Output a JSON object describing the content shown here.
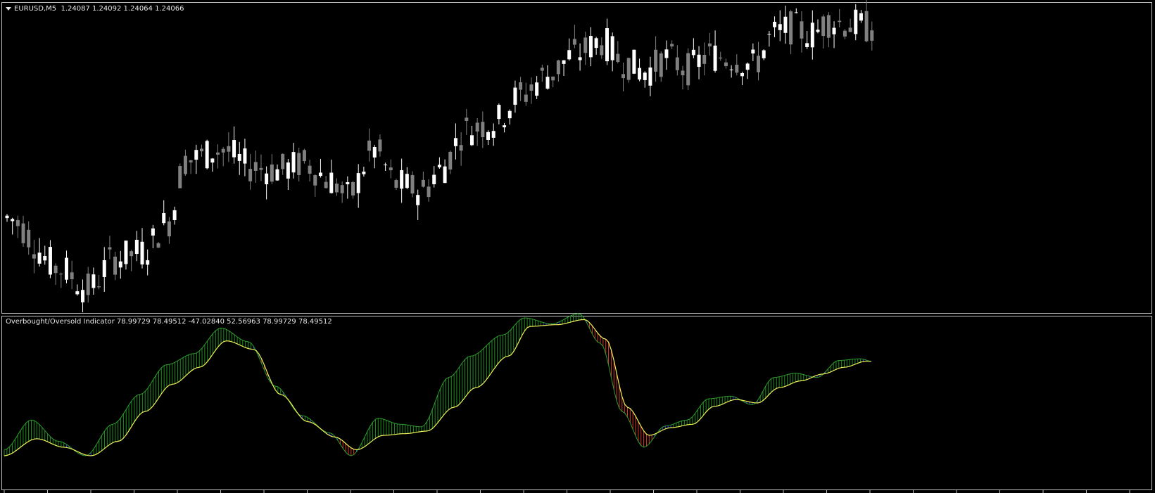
{
  "window": {
    "symbol": "EURUSD,M5",
    "ohlc": "1.24087 1.24092 1.24064 1.24066",
    "indicator_label": "Overbought/Oversold Indicator 78.99729 78.49512 -47.02840 52.56963 78.99729 78.49512"
  },
  "colors": {
    "background": "#000000",
    "border": "#c0c0c0",
    "bull_candle": "#ffffff",
    "bear_candle": "#808080",
    "osc_line_green": "#2e9b2e",
    "osc_line_yellow": "#f2f25a",
    "hist_green": "#1f8f1f",
    "hist_red": "#d43a2a",
    "hist_blue": "#2b3fd6"
  },
  "chart_data": [
    {
      "type": "candlestick",
      "title": "EURUSD,M5",
      "ylim": [
        1.2343,
        1.243
      ],
      "candle_count": 200,
      "anchors": [
        {
          "i": 0,
          "price": 1.237
        },
        {
          "i": 10,
          "price": 1.2355
        },
        {
          "i": 15,
          "price": 1.2349
        },
        {
          "i": 20,
          "price": 1.2358
        },
        {
          "i": 25,
          "price": 1.236
        },
        {
          "i": 30,
          "price": 1.2369
        },
        {
          "i": 33,
          "price": 1.2387
        },
        {
          "i": 40,
          "price": 1.239
        },
        {
          "i": 45,
          "price": 1.2385
        },
        {
          "i": 50,
          "price": 1.2384
        },
        {
          "i": 55,
          "price": 1.2386
        },
        {
          "i": 60,
          "price": 1.2381
        },
        {
          "i": 63,
          "price": 1.2376
        },
        {
          "i": 68,
          "price": 1.239
        },
        {
          "i": 72,
          "price": 1.238
        },
        {
          "i": 77,
          "price": 1.2378
        },
        {
          "i": 80,
          "price": 1.2384
        },
        {
          "i": 85,
          "price": 1.2396
        },
        {
          "i": 90,
          "price": 1.2398
        },
        {
          "i": 95,
          "price": 1.2406
        },
        {
          "i": 100,
          "price": 1.2412
        },
        {
          "i": 105,
          "price": 1.2418
        },
        {
          "i": 110,
          "price": 1.2422
        },
        {
          "i": 114,
          "price": 1.2416
        },
        {
          "i": 118,
          "price": 1.2413
        },
        {
          "i": 122,
          "price": 1.2417
        },
        {
          "i": 126,
          "price": 1.2414
        },
        {
          "i": 130,
          "price": 1.2418
        },
        {
          "i": 134,
          "price": 1.2417
        },
        {
          "i": 138,
          "price": 1.2415
        },
        {
          "i": 142,
          "price": 1.2424
        },
        {
          "i": 145,
          "price": 1.2426
        },
        {
          "i": 149,
          "price": 1.2424
        },
        {
          "i": 152,
          "price": 1.2428
        },
        {
          "i": 156,
          "price": 1.2427
        },
        {
          "i": 160,
          "price": 1.2426
        }
      ]
    },
    {
      "type": "line",
      "title": "Overbought/Oversold Indicator",
      "values_printed": [
        78.99729,
        78.49512,
        -47.0284,
        52.56963,
        78.99729,
        78.49512
      ],
      "ylim": [
        -100,
        100
      ],
      "series": [
        {
          "role": "fast",
          "anchors": [
            {
              "i": 0,
              "v": -55
            },
            {
              "i": 5,
              "v": -20
            },
            {
              "i": 10,
              "v": -45
            },
            {
              "i": 15,
              "v": -62
            },
            {
              "i": 20,
              "v": -25
            },
            {
              "i": 25,
              "v": 10
            },
            {
              "i": 30,
              "v": 45
            },
            {
              "i": 35,
              "v": 58
            },
            {
              "i": 40,
              "v": 88
            },
            {
              "i": 45,
              "v": 72
            },
            {
              "i": 50,
              "v": 20
            },
            {
              "i": 55,
              "v": -15
            },
            {
              "i": 60,
              "v": -35
            },
            {
              "i": 64,
              "v": -62
            },
            {
              "i": 69,
              "v": -18
            },
            {
              "i": 73,
              "v": -25
            },
            {
              "i": 77,
              "v": -28
            },
            {
              "i": 82,
              "v": 30
            },
            {
              "i": 86,
              "v": 55
            },
            {
              "i": 92,
              "v": 80
            },
            {
              "i": 96,
              "v": 100
            },
            {
              "i": 101,
              "v": 93
            },
            {
              "i": 106,
              "v": 105
            },
            {
              "i": 110,
              "v": 70
            },
            {
              "i": 114,
              "v": -10
            },
            {
              "i": 118,
              "v": -52
            },
            {
              "i": 122,
              "v": -27
            },
            {
              "i": 126,
              "v": -20
            },
            {
              "i": 130,
              "v": 5
            },
            {
              "i": 134,
              "v": 8
            },
            {
              "i": 138,
              "v": -2
            },
            {
              "i": 142,
              "v": 30
            },
            {
              "i": 146,
              "v": 35
            },
            {
              "i": 150,
              "v": 30
            },
            {
              "i": 154,
              "v": 50
            },
            {
              "i": 158,
              "v": 52
            },
            {
              "i": 160,
              "v": 49
            }
          ]
        },
        {
          "role": "slow",
          "anchors": [
            {
              "i": 0,
              "v": -62
            },
            {
              "i": 6,
              "v": -42
            },
            {
              "i": 11,
              "v": -52
            },
            {
              "i": 16,
              "v": -62
            },
            {
              "i": 21,
              "v": -45
            },
            {
              "i": 26,
              "v": -10
            },
            {
              "i": 31,
              "v": 22
            },
            {
              "i": 36,
              "v": 42
            },
            {
              "i": 41,
              "v": 73
            },
            {
              "i": 46,
              "v": 63
            },
            {
              "i": 51,
              "v": 10
            },
            {
              "i": 56,
              "v": -22
            },
            {
              "i": 61,
              "v": -40
            },
            {
              "i": 65,
              "v": -55
            },
            {
              "i": 70,
              "v": -38
            },
            {
              "i": 74,
              "v": -36
            },
            {
              "i": 78,
              "v": -33
            },
            {
              "i": 83,
              "v": -5
            },
            {
              "i": 87,
              "v": 18
            },
            {
              "i": 93,
              "v": 55
            },
            {
              "i": 97,
              "v": 90
            },
            {
              "i": 102,
              "v": 92
            },
            {
              "i": 107,
              "v": 98
            },
            {
              "i": 111,
              "v": 75
            },
            {
              "i": 115,
              "v": -5
            },
            {
              "i": 119,
              "v": -38
            },
            {
              "i": 123,
              "v": -29
            },
            {
              "i": 127,
              "v": -25
            },
            {
              "i": 131,
              "v": -4
            },
            {
              "i": 135,
              "v": 4
            },
            {
              "i": 139,
              "v": 0
            },
            {
              "i": 143,
              "v": 18
            },
            {
              "i": 147,
              "v": 26
            },
            {
              "i": 151,
              "v": 34
            },
            {
              "i": 155,
              "v": 42
            },
            {
              "i": 159,
              "v": 49
            },
            {
              "i": 160,
              "v": 49
            }
          ]
        }
      ]
    }
  ]
}
